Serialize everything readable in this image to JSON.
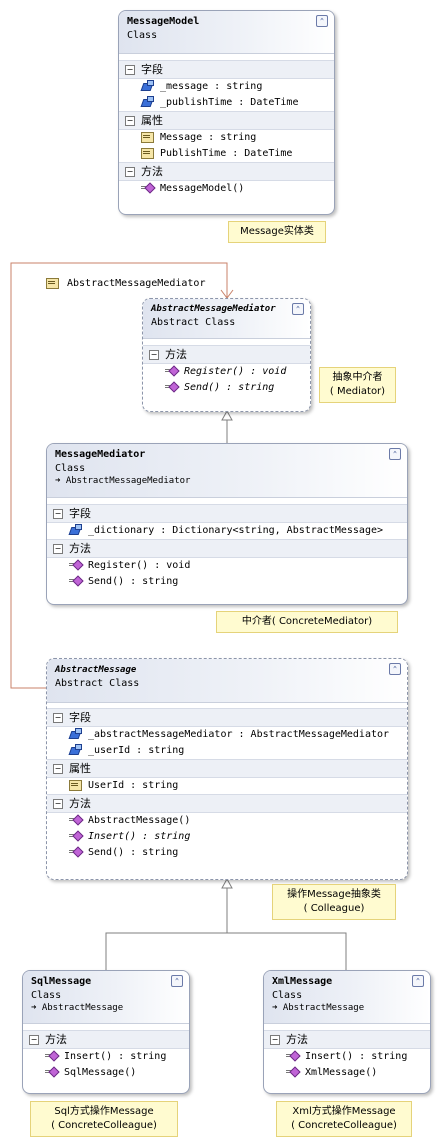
{
  "classes": {
    "message_model": {
      "name": "MessageModel",
      "kind": "Class",
      "sections": [
        {
          "label": "字段",
          "items": [
            "_message : string",
            "_publishTime : DateTime"
          ]
        },
        {
          "label": "属性",
          "items": [
            "Message : string",
            "PublishTime : DateTime"
          ]
        },
        {
          "label": "方法",
          "items": [
            "MessageModel()"
          ]
        }
      ]
    },
    "abstract_mediator": {
      "name": "AbstractMessageMediator",
      "kind": "Abstract Class",
      "sections": [
        {
          "label": "方法",
          "items": [
            "Register() : void",
            "Send() : string"
          ]
        }
      ]
    },
    "message_mediator": {
      "name": "MessageMediator",
      "kind": "Class",
      "inherits": "AbstractMessageMediator",
      "sections": [
        {
          "label": "字段",
          "items": [
            "_dictionary : Dictionary<string, AbstractMessage>"
          ]
        },
        {
          "label": "方法",
          "items": [
            "Register() : void",
            "Send() : string"
          ]
        }
      ]
    },
    "abstract_message": {
      "name": "AbstractMessage",
      "kind": "Abstract Class",
      "sections": [
        {
          "label": "字段",
          "items": [
            "_abstractMessageMediator : AbstractMessageMediator",
            "_userId : string"
          ]
        },
        {
          "label": "属性",
          "items": [
            "UserId : string"
          ]
        },
        {
          "label": "方法",
          "items": [
            "AbstractMessage()",
            "Insert() : string",
            "Send() : string"
          ]
        }
      ]
    },
    "sql_message": {
      "name": "SqlMessage",
      "kind": "Class",
      "inherits": "AbstractMessage",
      "sections": [
        {
          "label": "方法",
          "items": [
            "Insert() : string",
            "SqlMessage()"
          ]
        }
      ]
    },
    "xml_message": {
      "name": "XmlMessage",
      "kind": "Class",
      "inherits": "AbstractMessage",
      "sections": [
        {
          "label": "方法",
          "items": [
            "Insert() : string",
            "XmlMessage()"
          ]
        }
      ]
    }
  },
  "association_label": "AbstractMessageMediator",
  "notes": {
    "message_entity": "Message实体类",
    "abstract_mediator_line1": "抽象中介者",
    "abstract_mediator_line2": "( Mediator)",
    "concrete_mediator": "中介者( ConcreteMediator)",
    "colleague_line1": "操作Message抽象类",
    "colleague_line2": "( Colleague)",
    "sql_line1": "Sql方式操作Message",
    "sql_line2": "( ConcreteColleague)",
    "xml_line1": "Xml方式操作Message",
    "xml_line2": "( ConcreteColleague)"
  },
  "colors": {
    "inheritance_line": "#7f7f7f",
    "association_line": "#c8826a",
    "note_fill": "#fffbd0"
  }
}
